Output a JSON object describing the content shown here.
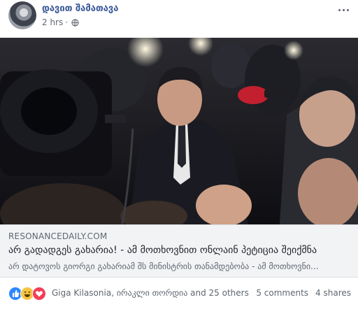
{
  "post": {
    "author": "დავით შამათავა",
    "time": "2 hrs",
    "time_separator": "·",
    "privacy_icon": "globe-icon",
    "more_icon": "more-horizontal-icon"
  },
  "link": {
    "domain": "RESONANCEDAILY.COM",
    "title": "არ გადადგეს გახარია! - ამ მოთხოვნით ონლაინ პეტიცია შეიქმნა",
    "description": "არ დატოვოს გიორგი გახარიამ შს მინისტრის თანამდებობა - ამ მოთხოვნი..."
  },
  "footer": {
    "reaction_icons": [
      "like-icon",
      "haha-icon",
      "love-icon"
    ],
    "names": "Giga Kilasonia, ირაკლი თორდია and 25 others",
    "comments": "5 comments",
    "shares": "4 shares"
  },
  "colors": {
    "author_link": "#385898",
    "secondary_text": "#606770",
    "link_background": "#f2f3f5",
    "like": "#2d88ff",
    "haha": "#f7c546",
    "love": "#f33e58"
  }
}
